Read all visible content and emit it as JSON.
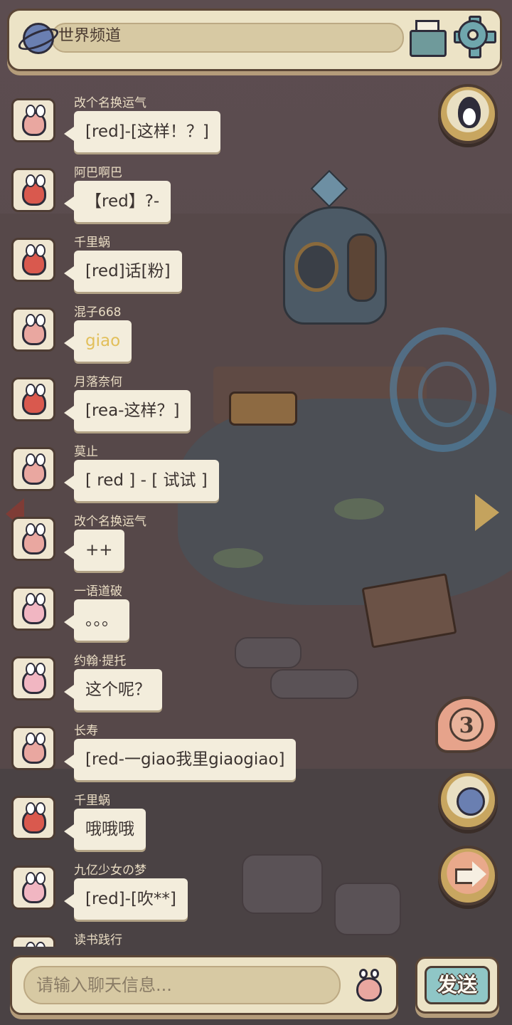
{
  "header": {
    "channel_label": "世界频道",
    "icons": [
      "planet-icon",
      "mail-icon",
      "gear-icon"
    ]
  },
  "messages": [
    {
      "user": "改个名换运气",
      "text": "[red]-[这样！？]",
      "avatar": "snail",
      "avatar_color": "#e9a7a0",
      "text_color": "#3b3330"
    },
    {
      "user": "阿巴啊巴",
      "text": "【red】?-",
      "avatar": "red-monster",
      "avatar_color": "#d9594e",
      "text_color": "#3b3330"
    },
    {
      "user": "千里蜗",
      "text": "[red]话[粉]",
      "avatar": "red-monster",
      "avatar_color": "#d9594e",
      "text_color": "#3b3330"
    },
    {
      "user": "混子668",
      "text": "giao",
      "avatar": "snail",
      "avatar_color": "#e9a7a0",
      "text_color": "#e2bf5a"
    },
    {
      "user": "月落奈何",
      "text": "[rea-这样？]",
      "avatar": "red-monster",
      "avatar_color": "#d9594e",
      "text_color": "#3b3330"
    },
    {
      "user": "莫止",
      "text": "[ red ] - [ 试试 ]",
      "avatar": "snail",
      "avatar_color": "#e9a7a0",
      "text_color": "#3b3330"
    },
    {
      "user": "改个名换运气",
      "text": "++",
      "avatar": "snail",
      "avatar_color": "#e9a7a0",
      "text_color": "#3b3330"
    },
    {
      "user": "一语道破",
      "text": "。。。",
      "avatar": "purple-snail",
      "avatar_color": "#f1b6c2",
      "text_color": "#3b3330"
    },
    {
      "user": "约翰·提托",
      "text": "这个呢？",
      "avatar": "purple-snail",
      "avatar_color": "#f1b6c2",
      "text_color": "#3b3330"
    },
    {
      "user": "长寿",
      "text": "[red-一giao我里giaogiao]",
      "avatar": "snail",
      "avatar_color": "#e9a7a0",
      "text_color": "#3b3330"
    },
    {
      "user": "千里蜗",
      "text": "哦哦哦",
      "avatar": "red-monster",
      "avatar_color": "#d9594e",
      "text_color": "#3b3330"
    },
    {
      "user": "九亿少女の梦",
      "text": "[red]-[吹**]",
      "avatar": "purple-snail",
      "avatar_color": "#f1b6c2",
      "text_color": "#3b3330"
    },
    {
      "user": "读书践行",
      "text": "",
      "avatar": "red-monster",
      "avatar_color": "#d9594e",
      "text_color": "#3b3330"
    }
  ],
  "side": {
    "unread_count": "3",
    "icons": [
      "qq-penguin-icon",
      "planet-icon",
      "arrow-right-icon"
    ]
  },
  "input": {
    "placeholder": "请输入聊天信息...",
    "value": "",
    "emoji_icon": "snail-emoji-icon"
  },
  "send_label": "发送",
  "colors": {
    "panel": "#ece3c6",
    "border": "#5b4636",
    "send_button": "#8fc6c6",
    "bubble": "#f3eddc",
    "badge": "#e6a38b"
  }
}
